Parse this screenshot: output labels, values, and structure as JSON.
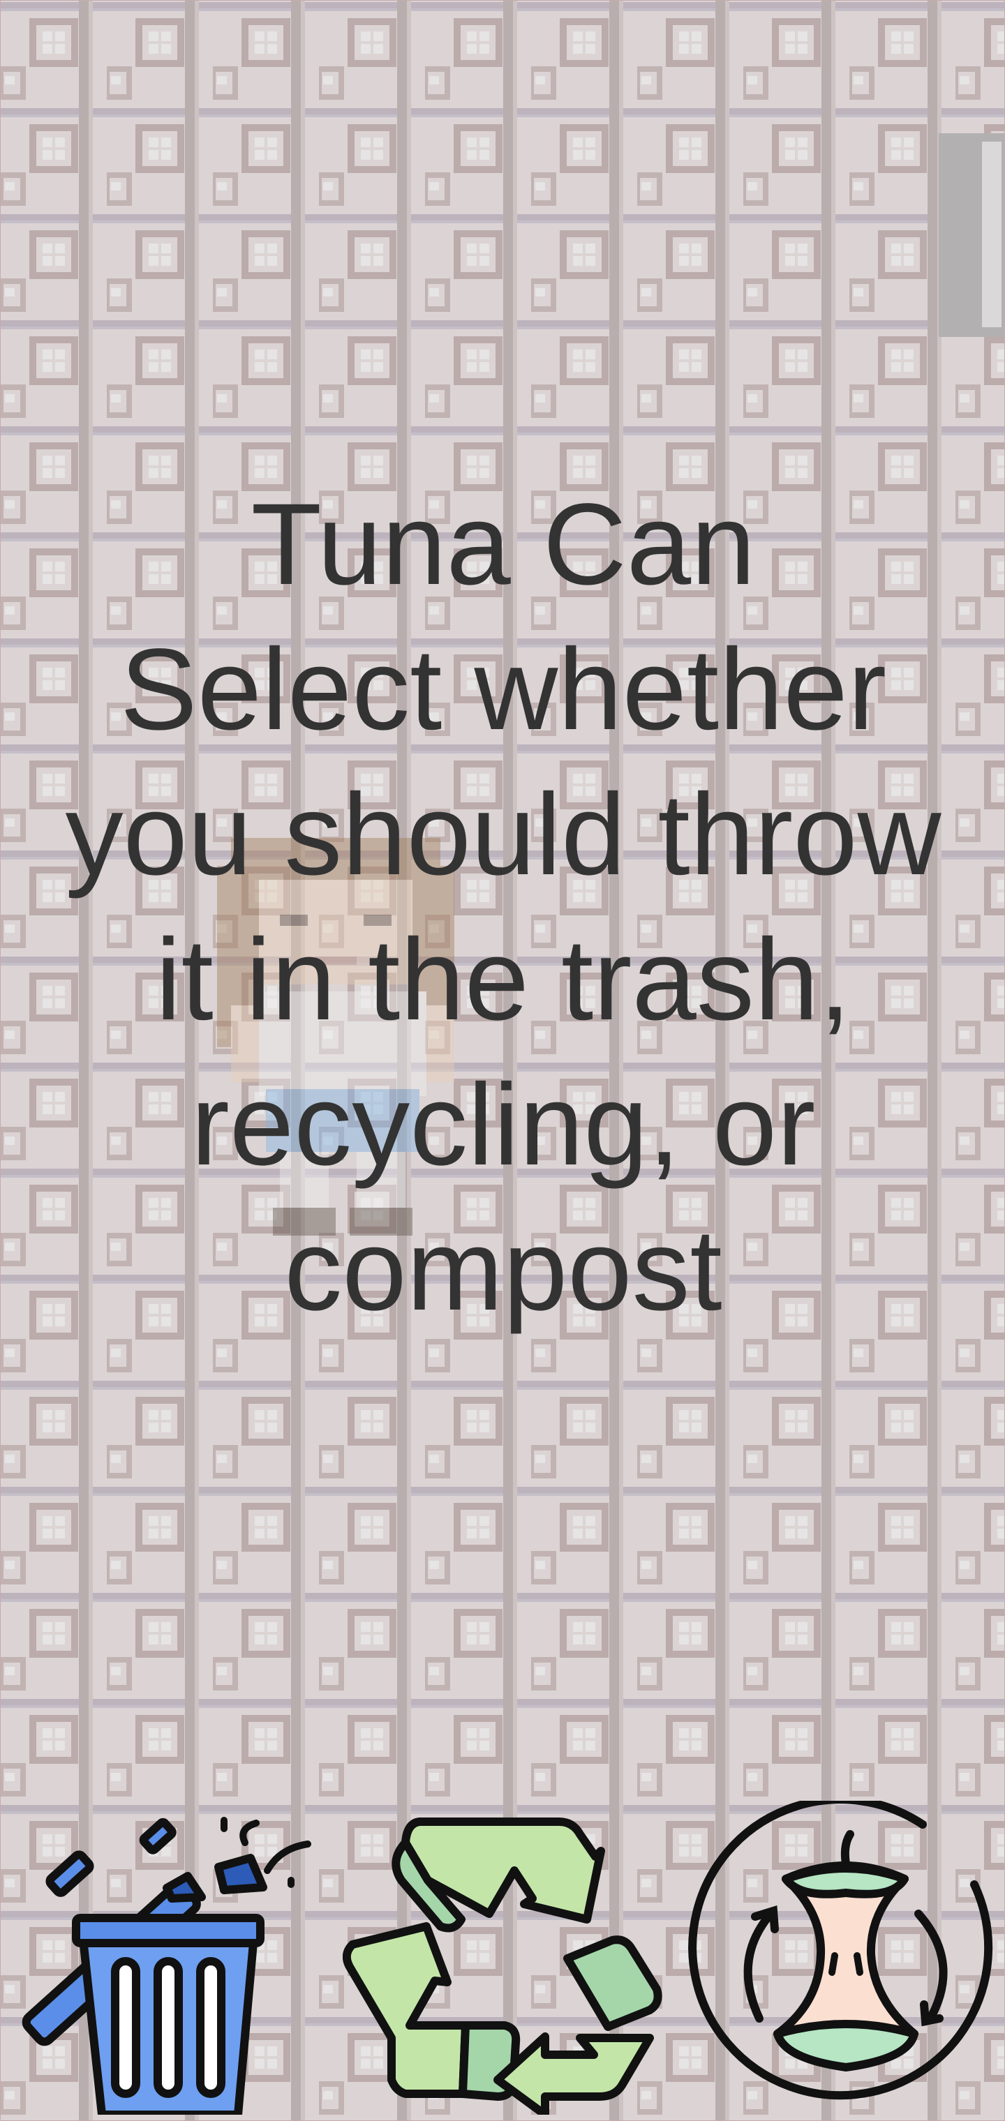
{
  "item": {
    "name": "Tuna Can"
  },
  "prompt": {
    "lines": [
      "Select whether",
      "you should throw",
      "it in the trash,",
      "recycling, or",
      "compost"
    ]
  },
  "choices": [
    {
      "id": "trash",
      "icon": "trash-bin-icon"
    },
    {
      "id": "recycling",
      "icon": "recycle-arrows-icon"
    },
    {
      "id": "compost",
      "icon": "apple-core-compost-icon"
    }
  ],
  "colors": {
    "background": "#dcd4d4",
    "text": "#333333",
    "trash_blue": "#5a8ee8",
    "recycle_green_light": "#c3e6a8",
    "recycle_green_dark": "#a5d6aa",
    "compost_flesh": "#fbe0d2",
    "compost_green": "#b6e6c4"
  }
}
